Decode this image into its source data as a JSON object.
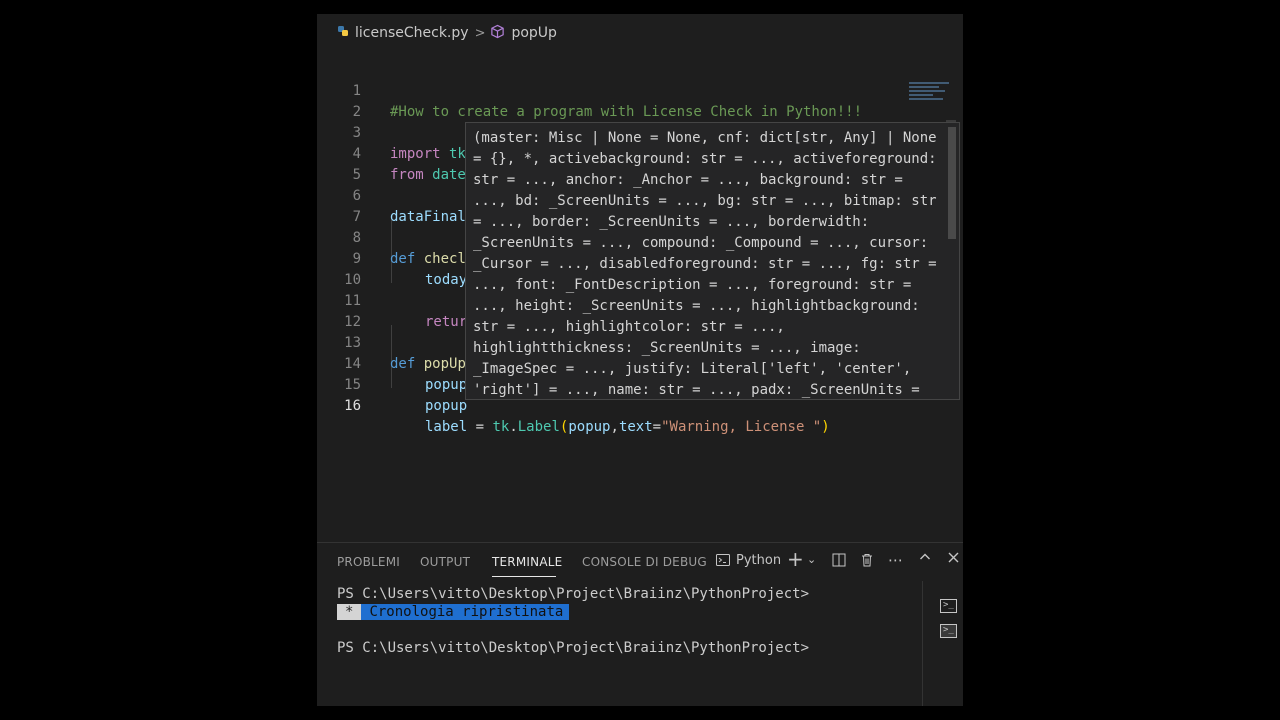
{
  "breadcrumb": {
    "file": "licenseCheck.py",
    "separator": ">",
    "symbol": "popUp",
    "file_icon": "python-icon",
    "symbol_icon": "cube-icon"
  },
  "editor": {
    "active_line": 16,
    "line_numbers": [
      "1",
      "2",
      "3",
      "4",
      "5",
      "6",
      "7",
      "8",
      "9",
      "10",
      "11",
      "12",
      "13",
      "14",
      "15",
      "16"
    ],
    "lines": {
      "l1": "#How to create a program with License Check in Python!!!",
      "l3_kw": "import",
      "l3_rest": " tk",
      "l4_kw": "from",
      "l4_rest": " date",
      "l6": "dataFinal",
      "l8_kw": "def",
      "l8_fn": " checl",
      "l9": "today",
      "l11": "retur",
      "l13_kw": "def",
      "l13_fn": " popUp",
      "l14": "popup",
      "l15": "popup",
      "l16_var": "label",
      "l16_eq": " = ",
      "l16_mod": "tk",
      "l16_dot": ".",
      "l16_cls": "Label",
      "l16_open": "(",
      "l16_arg": "popup",
      "l16_comma": ",",
      "l16_kwarg": "text",
      "l16_assign": "=",
      "l16_str": "\"Warning, License \"",
      "l16_close": ")"
    }
  },
  "hover": {
    "lines": [
      "(master: Misc | None = None, cnf: dict[str, Any] | None",
      "= {}, *, activebackground: str = ..., activeforeground:",
      "str = ..., anchor: _Anchor = ..., background: str =",
      "..., bd: _ScreenUnits = ..., bg: str = ..., bitmap: str",
      "= ..., border: _ScreenUnits = ..., borderwidth:",
      "_ScreenUnits = ..., compound: _Compound = ..., cursor:",
      "_Cursor = ..., disabledforeground: str = ..., fg: str =",
      "..., font: _FontDescription = ..., foreground: str =",
      "..., height: _ScreenUnits = ..., highlightbackground:",
      "str = ..., highlightcolor: str = ...,",
      "highlightthickness: _ScreenUnits = ..., image:",
      "_ImageSpec = ..., justify: Literal['left', 'center',",
      "'right'] = ..., name: str = ..., padx: _ScreenUnits ="
    ]
  },
  "panel": {
    "tabs": [
      "PROBLEMI",
      "OUTPUT",
      "TERMINALE",
      "CONSOLE DI DEBUG"
    ],
    "active_tab": "TERMINALE",
    "shell_label": "Python",
    "toolbar_icons": [
      "terminal-icon",
      "plus-icon",
      "chevron-down-icon",
      "split-icon",
      "trash-icon",
      "more-icon",
      "chevron-up-icon",
      "close-icon"
    ],
    "terminal": {
      "prompt1": "PS C:\\Users\\vitto\\Desktop\\Project\\Braiinz\\PythonProject>",
      "restored_star": "*",
      "restored_text": "Cronologia ripristinata",
      "prompt2": "PS C:\\Users\\vitto\\Desktop\\Project\\Braiinz\\PythonProject>"
    }
  },
  "colors": {
    "background": "#1e1e1e",
    "comment": "#6a9955",
    "keyword": "#c586c0",
    "accent": "#1f6fd0"
  }
}
